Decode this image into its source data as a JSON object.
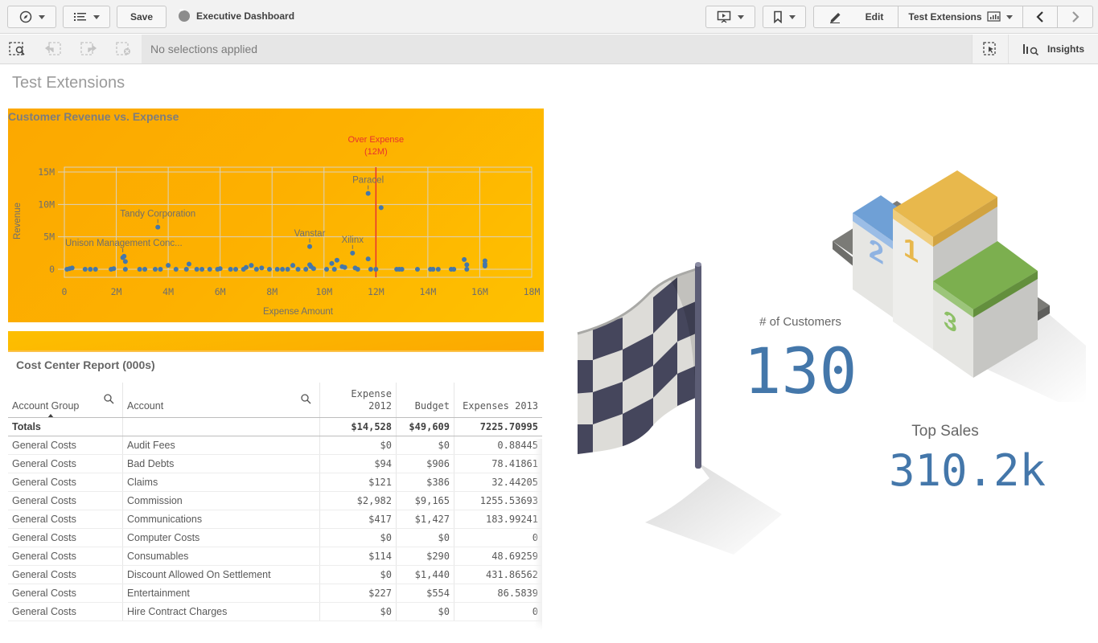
{
  "toolbar": {
    "save_label": "Save",
    "app_title": "Executive Dashboard",
    "edit_label": "Edit",
    "sheet_selector_label": "Test Extensions"
  },
  "selection_bar": {
    "status_text": "No selections applied",
    "insights_label": "Insights"
  },
  "sheet": {
    "title": "Test Extensions"
  },
  "chart_data": {
    "type": "scatter",
    "title": "Customer Revenue vs. Expense",
    "xlabel": "Expense Amount",
    "ylabel": "Revenue",
    "xlim": [
      0,
      18000000
    ],
    "ylim": [
      -500000,
      15000000
    ],
    "x_ticks": [
      "0",
      "2M",
      "4M",
      "6M",
      "8M",
      "10M",
      "12M",
      "14M",
      "16M",
      "18M"
    ],
    "y_ticks": [
      "0",
      "5M",
      "10M",
      "15M"
    ],
    "grid": true,
    "point_color": "#4477aa",
    "reference_line": {
      "label": "Over Expense",
      "value_label": "(12M)",
      "x": 12000000,
      "color": "#e8312f"
    },
    "labeled_points": [
      {
        "name": "Paracel",
        "x": 11700000,
        "y": 11700000
      },
      {
        "name": "Tandy Corporation",
        "x": 3600000,
        "y": 6500000
      },
      {
        "name": "Vanstar",
        "x": 9450000,
        "y": 3500000
      },
      {
        "name": "Xilinx",
        "x": 11100000,
        "y": 2500000
      },
      {
        "name": "Unison Management Conc...",
        "x": 2250000,
        "y": 2000000
      }
    ],
    "points": [
      [
        11700000,
        11700000
      ],
      [
        12200000,
        9500000
      ],
      [
        3600000,
        6500000
      ],
      [
        9450000,
        3500000
      ],
      [
        11100000,
        2500000
      ],
      [
        2250000,
        1800000
      ],
      [
        2300000,
        2000000
      ],
      [
        2350000,
        1200000
      ],
      [
        11700000,
        1600000
      ],
      [
        10500000,
        1400000
      ],
      [
        10300000,
        900000
      ],
      [
        15400000,
        1500000
      ],
      [
        15500000,
        700000
      ],
      [
        16200000,
        1300000
      ],
      [
        16200000,
        800000
      ],
      [
        16200000,
        500000
      ],
      [
        4800000,
        800000
      ],
      [
        4000000,
        600000
      ],
      [
        7200000,
        600000
      ],
      [
        7000000,
        300000
      ],
      [
        8800000,
        600000
      ],
      [
        9450000,
        700000
      ],
      [
        9500000,
        400000
      ],
      [
        10700000,
        400000
      ],
      [
        10800000,
        300000
      ],
      [
        11200000,
        200000
      ],
      [
        100000,
        0
      ],
      [
        200000,
        100000
      ],
      [
        300000,
        200000
      ],
      [
        800000,
        0
      ],
      [
        1000000,
        0
      ],
      [
        1200000,
        0
      ],
      [
        1800000,
        0
      ],
      [
        1900000,
        100000
      ],
      [
        2350000,
        0
      ],
      [
        2900000,
        0
      ],
      [
        3100000,
        0
      ],
      [
        3500000,
        0
      ],
      [
        3700000,
        0
      ],
      [
        4300000,
        0
      ],
      [
        4700000,
        0
      ],
      [
        5100000,
        0
      ],
      [
        5300000,
        0
      ],
      [
        5600000,
        0
      ],
      [
        5900000,
        0
      ],
      [
        6000000,
        100000
      ],
      [
        6400000,
        0
      ],
      [
        6600000,
        0
      ],
      [
        6900000,
        0
      ],
      [
        7400000,
        0
      ],
      [
        7600000,
        200000
      ],
      [
        7900000,
        0
      ],
      [
        8200000,
        0
      ],
      [
        8400000,
        0
      ],
      [
        8600000,
        0
      ],
      [
        9000000,
        0
      ],
      [
        9300000,
        0
      ],
      [
        9600000,
        100000
      ],
      [
        10100000,
        0
      ],
      [
        10400000,
        0
      ],
      [
        11300000,
        0
      ],
      [
        11800000,
        0
      ],
      [
        12000000,
        0
      ],
      [
        12800000,
        0
      ],
      [
        12900000,
        0
      ],
      [
        13000000,
        0
      ],
      [
        13600000,
        0
      ],
      [
        14100000,
        0
      ],
      [
        14200000,
        0
      ],
      [
        14400000,
        0
      ],
      [
        14900000,
        0
      ],
      [
        15000000,
        0
      ],
      [
        15500000,
        0
      ]
    ]
  },
  "table": {
    "title": "Cost Center Report (000s)",
    "columns": [
      "Account Group",
      "Account",
      "Expense 2012",
      "Budget",
      "Expenses 2013"
    ],
    "totals": {
      "label": "Totals",
      "expense_2012": "$14,528",
      "budget": "$49,609",
      "expenses_2013": "7225.70995"
    },
    "rows": [
      [
        "General Costs",
        "Audit Fees",
        "$0",
        "$0",
        "0.88445"
      ],
      [
        "General Costs",
        "Bad Debts",
        "$94",
        "$906",
        "78.41861"
      ],
      [
        "General Costs",
        "Claims",
        "$121",
        "$386",
        "32.44205"
      ],
      [
        "General Costs",
        "Commission",
        "$2,982",
        "$9,165",
        "1255.53693"
      ],
      [
        "General Costs",
        "Communications",
        "$417",
        "$1,427",
        "183.99241"
      ],
      [
        "General Costs",
        "Computer Costs",
        "$0",
        "$0",
        "0"
      ],
      [
        "General Costs",
        "Consumables",
        "$114",
        "$290",
        "48.69259"
      ],
      [
        "General Costs",
        "Discount Allowed On Settlement",
        "$0",
        "$1,440",
        "431.86562"
      ],
      [
        "General Costs",
        "Entertainment",
        "$227",
        "$554",
        "86.5839"
      ],
      [
        "General Costs",
        "Hire Contract Charges",
        "$0",
        "$0",
        "0"
      ]
    ]
  },
  "kpis": {
    "customers": {
      "label": "# of Customers",
      "value": "130"
    },
    "top_sales": {
      "label": "Top Sales",
      "value": "310.2k"
    }
  },
  "colors": {
    "kpi_value": "#4477aa",
    "chart_bg_start": "#fca800",
    "chart_bg_end": "#fec100",
    "reference_line": "#e8312f",
    "podium_first": "#e8b84c",
    "podium_second": "#6fa0d6",
    "podium_third": "#7caf4f"
  }
}
